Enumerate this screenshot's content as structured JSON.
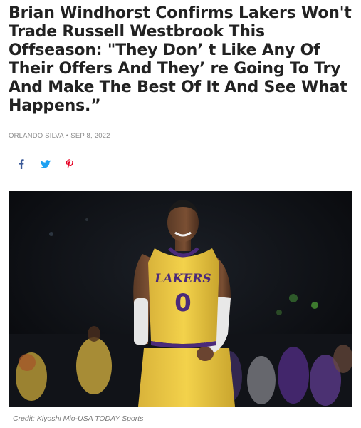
{
  "article": {
    "headline": "Brian Windhorst Confirms Lakers Won't Trade Russell Westbrook This Offseason: \"They Don’ t Like Any Of Their Offers And They’ re Going To Try And Make The Best Of It And See What Happens.”",
    "author": "ORLANDO SILVA",
    "separator": "•",
    "date": "SEP 8, 2022"
  },
  "share": {
    "icons": [
      "facebook-icon",
      "twitter-icon",
      "pinterest-icon"
    ],
    "colors": {
      "facebook": "#3b5998",
      "twitter": "#1da1f2",
      "pinterest": "#e60023"
    }
  },
  "photo": {
    "jersey_team": "LAKERS",
    "jersey_number": "0",
    "jersey_color": "#f3d24b",
    "jersey_trim": "#4b2a7a"
  },
  "caption": {
    "credit": "Credit: Kiyoshi Mio-USA TODAY Sports"
  }
}
